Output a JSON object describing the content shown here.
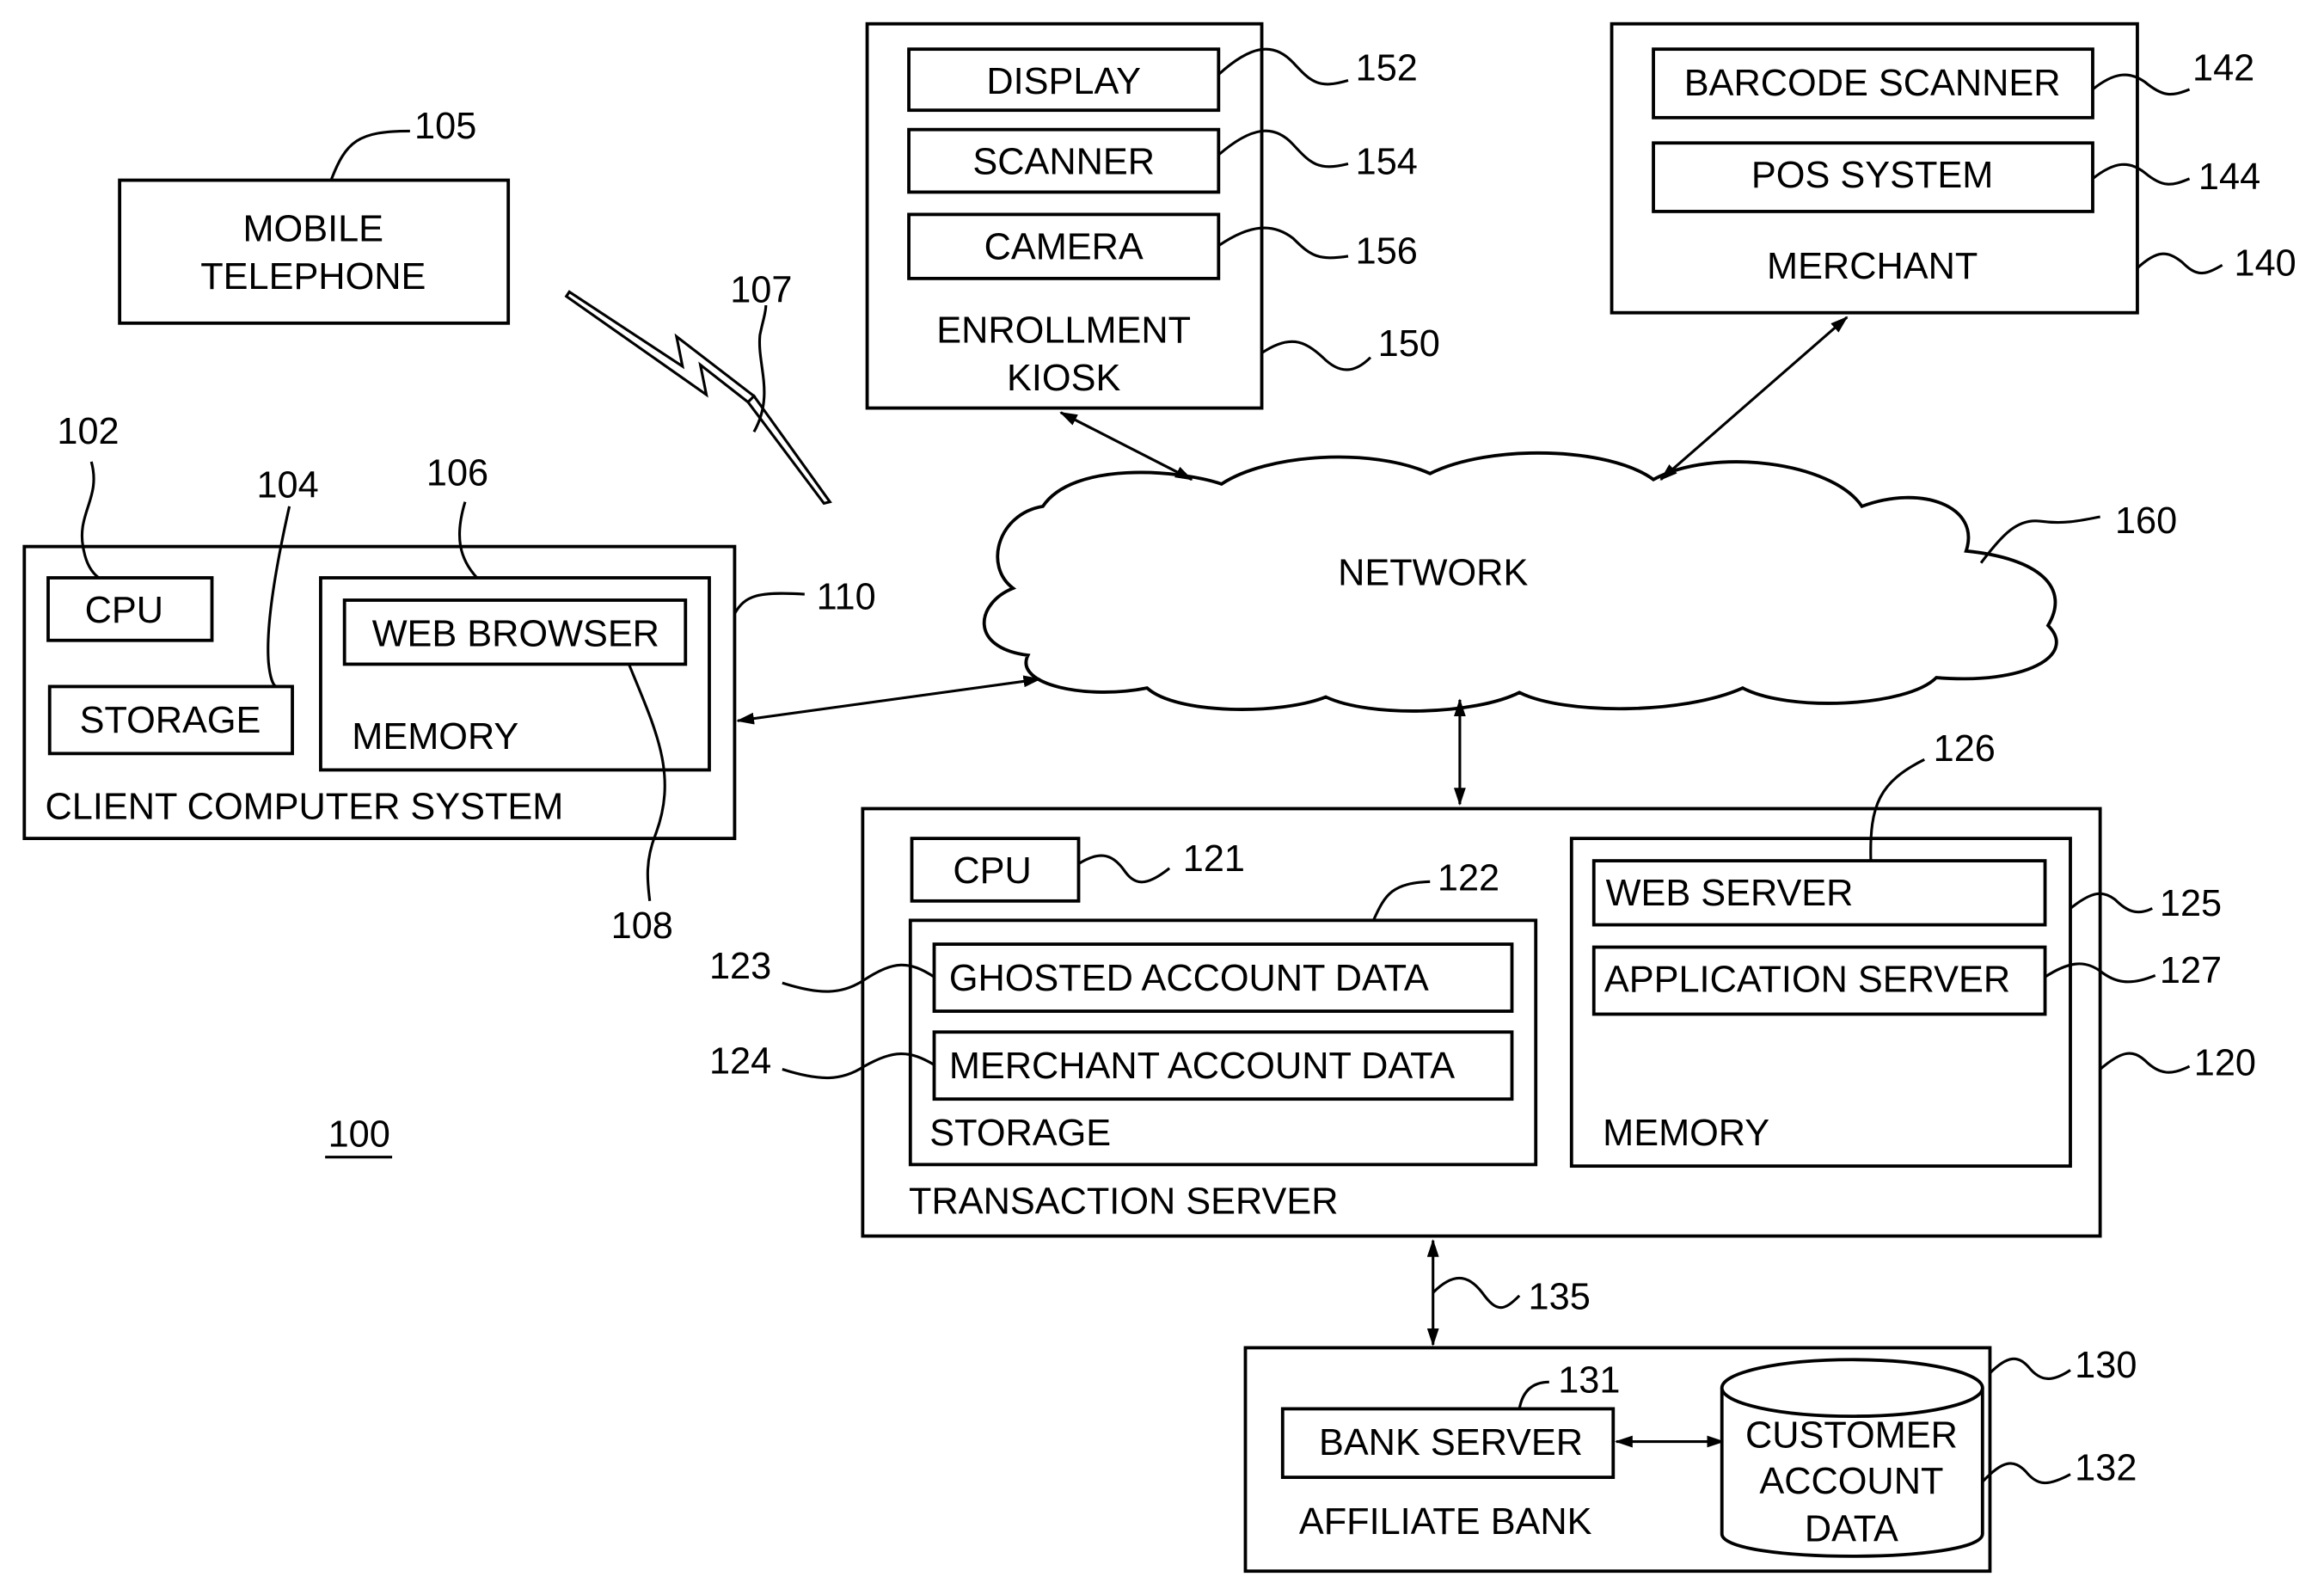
{
  "figure_number": "100",
  "mobile": {
    "ref": "105",
    "label_line1": "MOBILE",
    "label_line2": "TELEPHONE",
    "link_ref": "107"
  },
  "client": {
    "ref": "110",
    "label": "CLIENT COMPUTER SYSTEM",
    "cpu": {
      "ref": "102",
      "label": "CPU"
    },
    "storage": {
      "ref": "104",
      "label": "STORAGE"
    },
    "memory": {
      "ref": "106",
      "label": "MEMORY"
    },
    "browser": {
      "ref": "108",
      "label": "WEB BROWSER"
    }
  },
  "kiosk": {
    "ref": "150",
    "label_line1": "ENROLLMENT",
    "label_line2": "KIOSK",
    "display": {
      "ref": "152",
      "label": "DISPLAY"
    },
    "scanner": {
      "ref": "154",
      "label": "SCANNER"
    },
    "camera": {
      "ref": "156",
      "label": "CAMERA"
    }
  },
  "merchant": {
    "ref": "140",
    "label": "MERCHANT",
    "barcode": {
      "ref": "142",
      "label": "BARCODE SCANNER"
    },
    "pos": {
      "ref": "144",
      "label": "POS SYSTEM"
    }
  },
  "network": {
    "ref": "160",
    "label": "NETWORK"
  },
  "transaction_server": {
    "ref": "120",
    "label": "TRANSACTION SERVER",
    "cpu": {
      "ref": "121",
      "label": "CPU"
    },
    "storage": {
      "ref": "122",
      "label": "STORAGE"
    },
    "ghosted": {
      "ref": "123",
      "label": "GHOSTED ACCOUNT DATA"
    },
    "merchant_data": {
      "ref": "124",
      "label": "MERCHANT ACCOUNT DATA"
    },
    "memory": {
      "ref": "125",
      "label": "MEMORY"
    },
    "web_server": {
      "ref": "126",
      "label": "WEB SERVER"
    },
    "app_server": {
      "ref": "127",
      "label": "APPLICATION SERVER"
    }
  },
  "bank_link": {
    "ref": "135"
  },
  "bank": {
    "ref": "130",
    "label": "AFFILIATE BANK",
    "server": {
      "ref": "131",
      "label": "BANK SERVER"
    },
    "db": {
      "ref": "132",
      "line1": "CUSTOMER",
      "line2": "ACCOUNT",
      "line3": "DATA"
    }
  }
}
